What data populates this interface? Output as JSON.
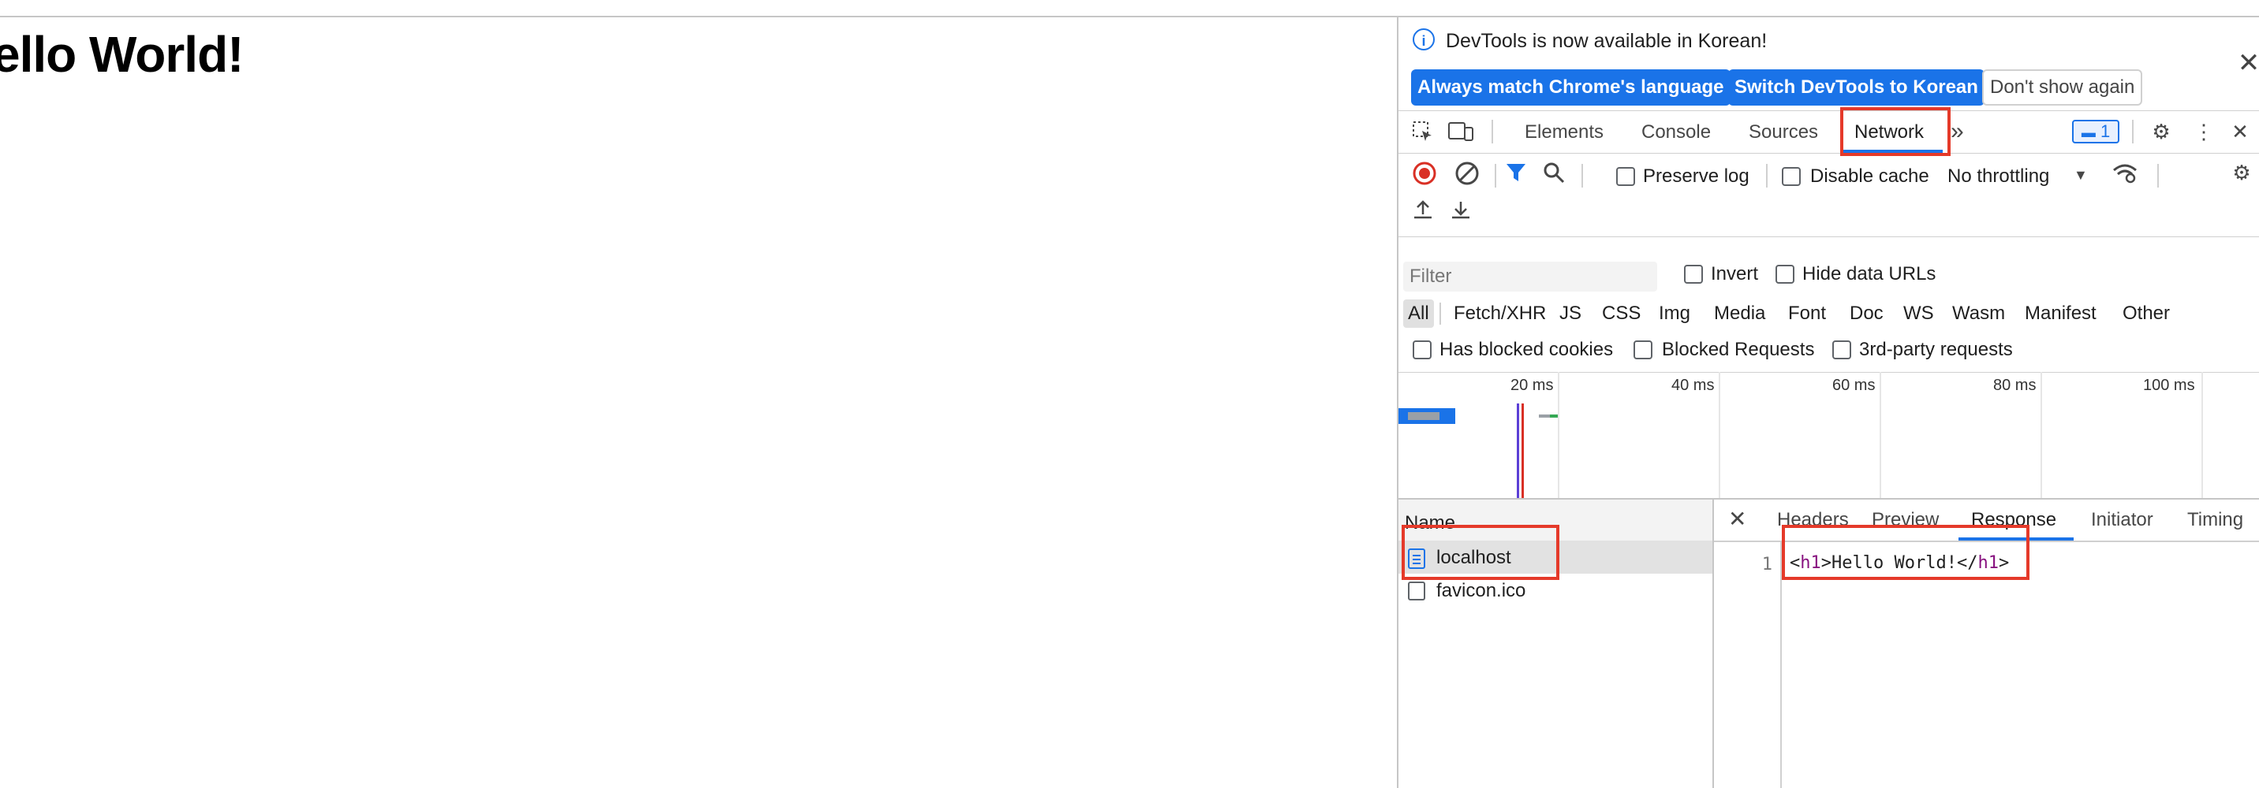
{
  "page": {
    "heading": "ello World!"
  },
  "banner": {
    "message": "DevTools is now available in Korean!",
    "btn_match": "Always match Chrome's language",
    "btn_switch": "Switch DevTools to Korean",
    "btn_dont_show": "Don't show again",
    "close": "✕"
  },
  "toolbar": {
    "tabs": [
      "Elements",
      "Console",
      "Sources",
      "Network"
    ],
    "active_tab": "Network",
    "more": "»",
    "issues_count": "1"
  },
  "network_controls": {
    "preserve_log": "Preserve log",
    "disable_cache": "Disable cache",
    "throttling": "No throttling"
  },
  "filter": {
    "placeholder": "Filter",
    "invert": "Invert",
    "hide_data_urls": "Hide data URLs",
    "types": [
      "All",
      "Fetch/XHR",
      "JS",
      "CSS",
      "Img",
      "Media",
      "Font",
      "Doc",
      "WS",
      "Wasm",
      "Manifest",
      "Other"
    ],
    "has_blocked_cookies": "Has blocked cookies",
    "blocked_requests": "Blocked Requests",
    "third_party": "3rd-party requests"
  },
  "timeline": {
    "ticks": [
      "20 ms",
      "40 ms",
      "60 ms",
      "80 ms",
      "100 ms"
    ]
  },
  "requests": {
    "column_name": "Name",
    "rows": [
      {
        "name": "localhost",
        "selected": true
      },
      {
        "name": "favicon.ico",
        "selected": false
      }
    ]
  },
  "detail": {
    "tabs": [
      "Headers",
      "Preview",
      "Response",
      "Initiator",
      "Timing"
    ],
    "active_tab": "Response",
    "line_number": "1",
    "code": {
      "open_lt": "<",
      "open_tag": "h1",
      "open_gt": ">",
      "text": "Hello World!",
      "close_lt": "</",
      "close_tag": "h1",
      "close_gt": ">"
    }
  },
  "colors": {
    "accent": "#1a73e8",
    "highlight": "#e53a2a"
  }
}
